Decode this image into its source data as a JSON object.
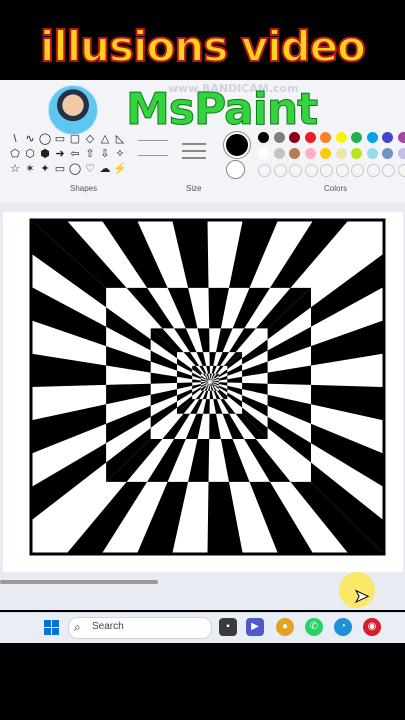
{
  "overlay": {
    "title": "illusions video",
    "watermark": "www.BANDICAM.com",
    "subtitle": "MsPaint"
  },
  "ribbon": {
    "groups": [
      "Shapes",
      "Size",
      "Colors"
    ],
    "shape_tools": [
      "\\",
      "∿",
      "◯",
      "▭",
      "▢",
      "◇",
      "△",
      "◺",
      "⬠",
      "⬡",
      "⬢",
      "➜",
      "⇦",
      "⇧",
      "⇩",
      "✧",
      "☆",
      "✶",
      "✦",
      "▭",
      "◯",
      "♡",
      "☁",
      "⚡"
    ],
    "palette": [
      "#000000",
      "#7f7f7f",
      "#880015",
      "#ed1c24",
      "#ff7f27",
      "#fff200",
      "#22b14c",
      "#00a2e8",
      "#3f48cc",
      "#a349a4",
      "#ffffff",
      "#c3c3c3",
      "#b97a57",
      "#ffaec9",
      "#ffc90e",
      "#efe4b0",
      "#b5e61d",
      "#99d9ea",
      "#7092be",
      "#c8bfe7",
      "#f5f5f5",
      "#f5f5f5",
      "#f5f5f5",
      "#f5f5f5",
      "#f5f5f5",
      "#f5f5f5",
      "#f5f5f5",
      "#f5f5f5",
      "#f5f5f5",
      "#f5f5f5"
    ]
  },
  "taskbar": {
    "search_placeholder": "Search",
    "apps": [
      "file-explorer",
      "teams",
      "chrome",
      "whatsapp",
      "edge",
      "bandicam"
    ]
  },
  "canvas": {
    "drawing": "checkerboard tunnel illusion",
    "colors": [
      "#000000",
      "#ffffff"
    ]
  }
}
